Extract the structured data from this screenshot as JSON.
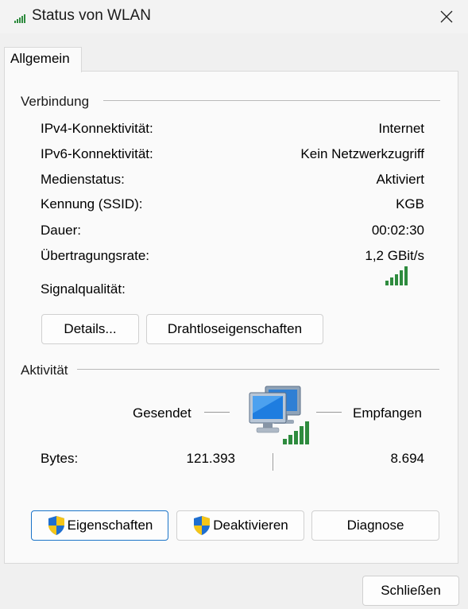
{
  "window": {
    "title": "Status von WLAN",
    "title_icon": "wifi-signal-icon",
    "close_icon": "close-icon"
  },
  "tabs": [
    {
      "label": "Allgemein",
      "selected": true
    }
  ],
  "connection": {
    "title": "Verbindung",
    "rows": [
      {
        "label": "IPv4-Konnektivität:",
        "value": "Internet"
      },
      {
        "label": "IPv6-Konnektivität:",
        "value": "Kein Netzwerkzugriff"
      },
      {
        "label": "Medienstatus:",
        "value": "Aktiviert"
      },
      {
        "label": "Kennung (SSID):",
        "value": "KGB"
      },
      {
        "label": "Dauer:",
        "value": "00:02:30"
      },
      {
        "label": "Übertragungsrate:",
        "value": "1,2 GBit/s"
      }
    ],
    "signal_label": "Signalqualität:",
    "signal_bars": 5,
    "signal_color": "#2e8b3e",
    "buttons": {
      "details": "Details...",
      "wireless_properties": "Drahtloseigenschaften"
    }
  },
  "activity": {
    "title": "Aktivität",
    "sent_label": "Gesendet",
    "received_label": "Empfangen",
    "bytes_label": "Bytes:",
    "bytes_sent": "121.393",
    "bytes_received": "8.694",
    "network_icon": "network-computers-icon"
  },
  "actions": {
    "properties": "Eigenschaften",
    "disable": "Deaktivieren",
    "diagnose": "Diagnose",
    "shield_icon": "uac-shield-icon"
  },
  "footer": {
    "close": "Schließen"
  }
}
